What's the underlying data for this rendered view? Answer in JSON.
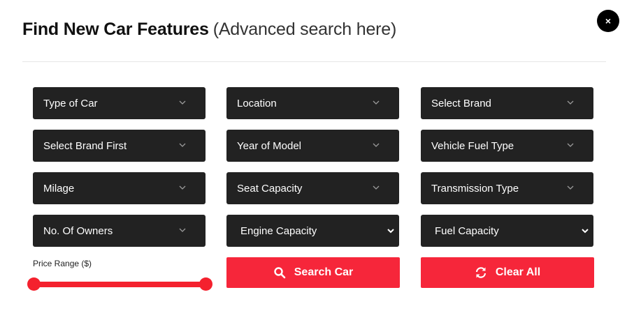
{
  "header": {
    "title": "Find New Car Features",
    "subtitle": "(Advanced search here)",
    "close_label": "×"
  },
  "filters": {
    "type_of_car": "Type of Car",
    "location": "Location",
    "select_brand": "Select Brand",
    "select_brand_first": "Select Brand First",
    "year_of_model": "Year of Model",
    "vehicle_fuel_type": "Vehicle Fuel Type",
    "milage": "Milage",
    "seat_capacity": "Seat Capacity",
    "transmission_type": "Transmission Type",
    "no_of_owners": "No. Of Owners",
    "engine_capacity": "Engine Capacity",
    "fuel_capacity": "Fuel Capacity"
  },
  "price_range": {
    "label": "Price Range ($)",
    "min_fraction": 0,
    "max_fraction": 1
  },
  "actions": {
    "search_label": "Search Car",
    "clear_label": "Clear All"
  },
  "icons": {
    "search": "search-icon",
    "clear": "sync-icon",
    "chevron": "chevron-down-icon"
  },
  "colors": {
    "accent": "#f6263a",
    "select_bg": "#222222",
    "close_bg": "#000000"
  }
}
